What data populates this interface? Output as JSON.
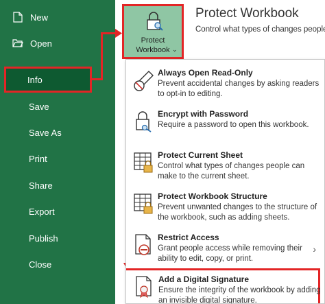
{
  "sidebar": {
    "items": [
      {
        "label": "New",
        "icon": "new-file-icon"
      },
      {
        "label": "Open",
        "icon": "open-folder-icon"
      },
      {
        "label": "Info",
        "active": true
      },
      {
        "label": "Save"
      },
      {
        "label": "Save As"
      },
      {
        "label": "Print"
      },
      {
        "label": "Share"
      },
      {
        "label": "Export"
      },
      {
        "label": "Publish"
      },
      {
        "label": "Close"
      }
    ]
  },
  "protect_button": {
    "line1": "Protect",
    "line2": "Workbook",
    "icon": "lock-search-icon"
  },
  "panel": {
    "title": "Protect Workbook",
    "description": "Control what types of changes people"
  },
  "menu": {
    "items": [
      {
        "title": "Always Open Read-Only",
        "description": "Prevent accidental changes by asking readers to opt-in to editing.",
        "icon": "pencil-no-icon"
      },
      {
        "title": "Encrypt with Password",
        "description": "Require a password to open this workbook.",
        "icon": "lock-key-icon"
      },
      {
        "title": "Protect Current Sheet",
        "description": "Control what types of changes people can make to the current sheet.",
        "icon": "sheet-lock-icon"
      },
      {
        "title": "Protect Workbook Structure",
        "description": "Prevent unwanted changes to the structure of the workbook, such as adding sheets.",
        "icon": "workbook-lock-icon"
      },
      {
        "title": "Restrict Access",
        "description": "Grant people access while removing their ability to edit, copy, or print.",
        "icon": "restrict-access-icon"
      },
      {
        "title": "Add a Digital Signature",
        "description": "Ensure the integrity of the workbook by adding an invisible digital signature.",
        "icon": "signature-icon"
      }
    ]
  },
  "colors": {
    "sidebar": "#217346",
    "active": "#0e5a31",
    "highlight": "#e32526",
    "button": "#8fc6a4"
  }
}
